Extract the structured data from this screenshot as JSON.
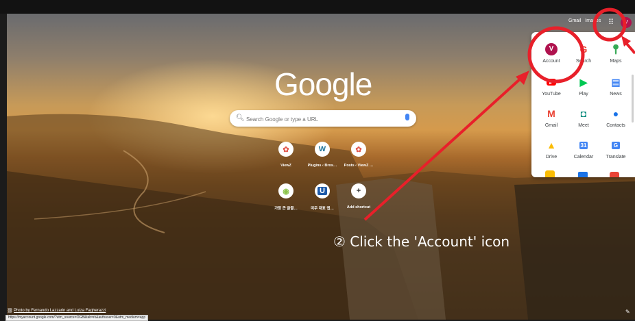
{
  "header": {
    "gmail": "Gmail",
    "images": "Images",
    "avatar_letter": "V"
  },
  "logo": "Google",
  "search": {
    "placeholder": "Search Google or type a URL"
  },
  "shortcuts": [
    {
      "label": "ViewZ",
      "icon": "ViewZ-icon"
    },
    {
      "label": "Plugins ‹ Bros…",
      "icon": "wordpress-icon"
    },
    {
      "label": "Posts ‹ ViewZ …",
      "icon": "ViewZ-icon"
    },
    {
      "label": "가장 큰 글꼴…",
      "icon": "circle-icon"
    },
    {
      "label": "미주 대표 앱…",
      "icon": "u-icon"
    },
    {
      "label": "Add shortcut",
      "icon": "plus-icon"
    }
  ],
  "apps": [
    {
      "label": "Account",
      "glyph": "V",
      "color": "#b0134f"
    },
    {
      "label": "Search",
      "glyph": "G",
      "color": "#ea4335"
    },
    {
      "label": "Maps",
      "glyph": "⬤",
      "color": "#34a853"
    },
    {
      "label": "YouTube",
      "glyph": "▶",
      "color": "#ff0000"
    },
    {
      "label": "Play",
      "glyph": "▶",
      "color": "#00c853"
    },
    {
      "label": "News",
      "glyph": "▤",
      "color": "#4285f4"
    },
    {
      "label": "Gmail",
      "glyph": "M",
      "color": "#ea4335"
    },
    {
      "label": "Meet",
      "glyph": "◘",
      "color": "#00897b"
    },
    {
      "label": "Contacts",
      "glyph": "●",
      "color": "#1a73e8"
    },
    {
      "label": "Drive",
      "glyph": "▲",
      "color": "#fbbc04"
    },
    {
      "label": "Calendar",
      "glyph": "31",
      "color": "#4285f4"
    },
    {
      "label": "Translate",
      "glyph": "G",
      "color": "#4285f4"
    }
  ],
  "footer": {
    "credit": "Photo by Fernando Lazzarin and Luiza Fagherazzi",
    "status_url": "https://myaccount.google.com/?utm_source=OGB&tab=rk&authuser=0&utm_medium=app"
  },
  "instruction": "② Click the 'Account' icon",
  "colors": {
    "annotation": "#e8202a"
  }
}
